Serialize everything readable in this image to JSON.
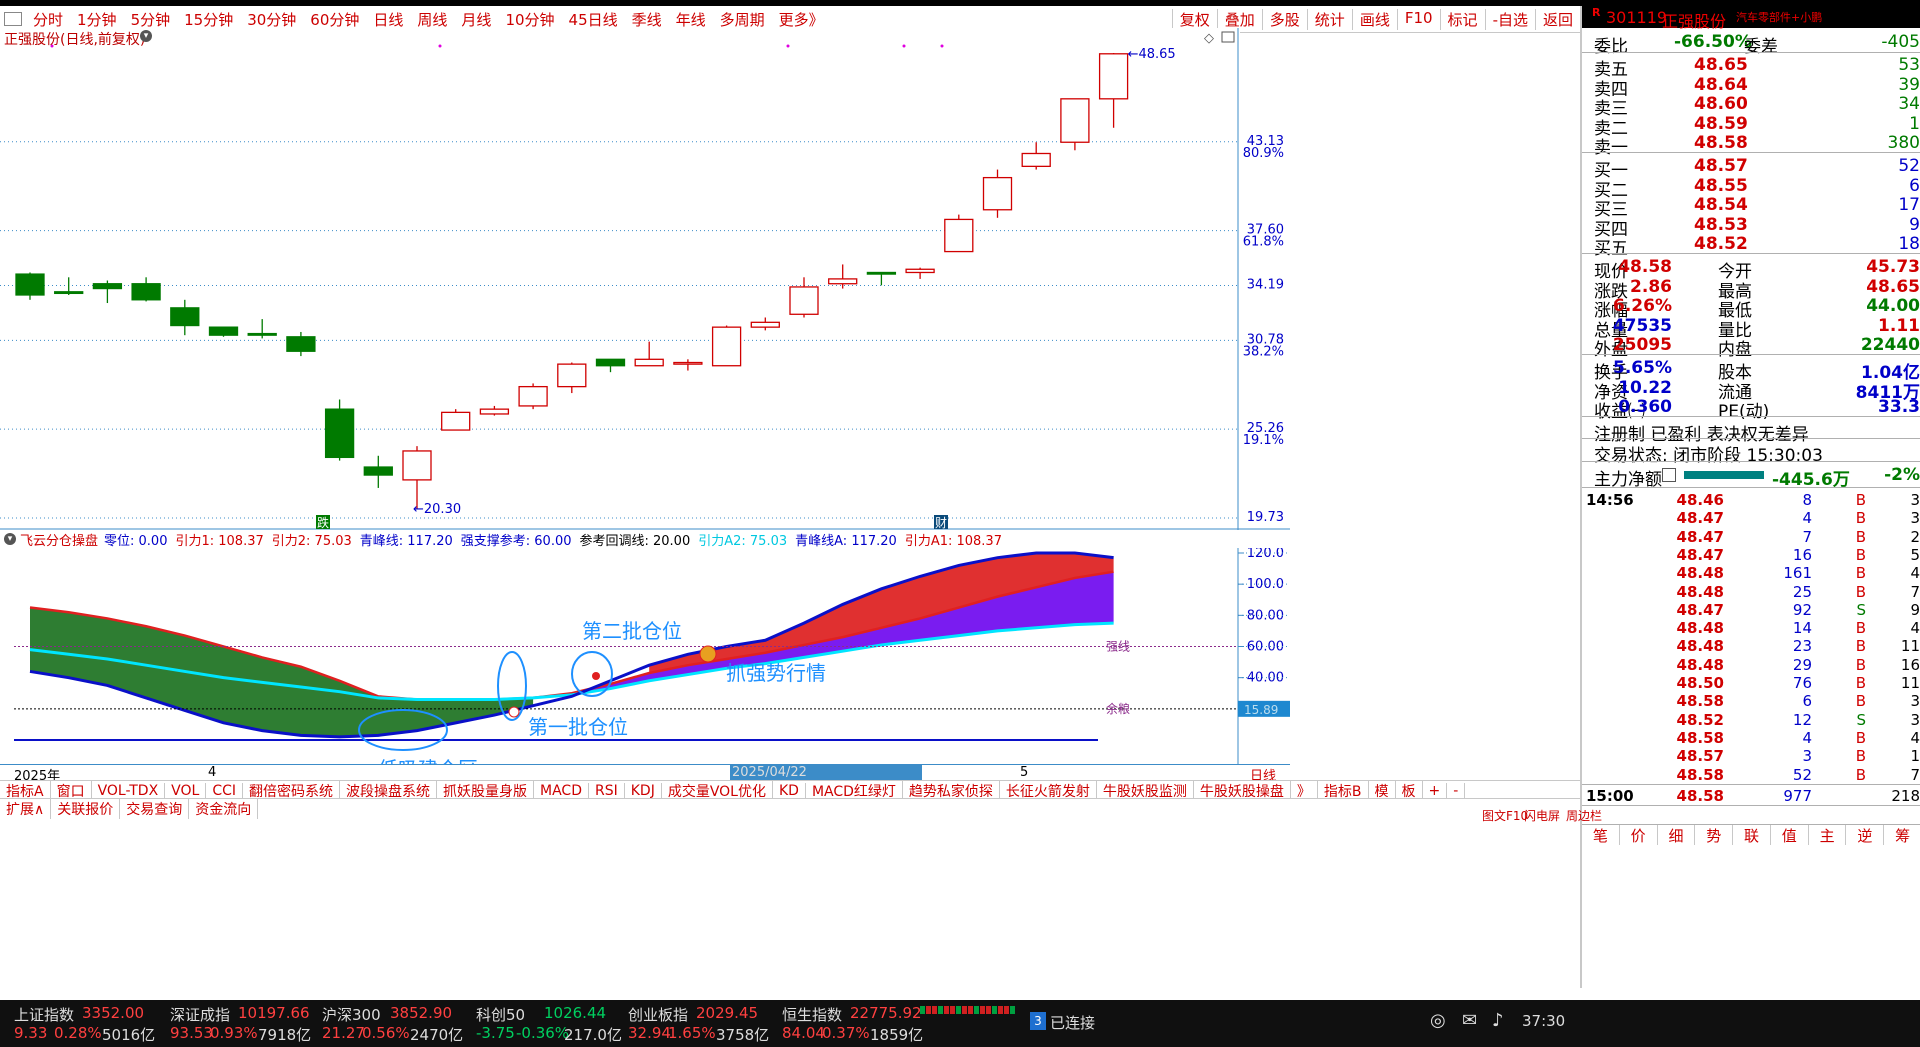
{
  "period_tabs": [
    "分时",
    "1分钟",
    "5分钟",
    "15分钟",
    "30分钟",
    "60分钟",
    "日线",
    "周线",
    "月线",
    "10分钟",
    "45日线",
    "季线",
    "年线",
    "多周期",
    "更多》"
  ],
  "tools": [
    "复权",
    "叠加",
    "多股",
    "统计",
    "画线",
    "F10",
    "标记",
    "-自选",
    "返回"
  ],
  "chart_title": "正强股份(日线,前复权)",
  "main_chart": {
    "price_levels": [
      {
        "price": "43.13",
        "pct": "80.9%"
      },
      {
        "price": "37.60",
        "pct": "61.8%"
      },
      {
        "price": "34.19",
        "pct": ""
      },
      {
        "price": "30.78",
        "pct": "38.2%"
      },
      {
        "price": "25.26",
        "pct": "19.1%"
      },
      {
        "price": "19.73",
        "pct": ""
      }
    ],
    "high_label": "48.65",
    "low_label": "20.30",
    "marker_left": "跌",
    "marker_right": "财",
    "candles": [
      {
        "o": 34.9,
        "c": 33.6,
        "h": 35.0,
        "l": 33.3
      },
      {
        "o": 33.8,
        "c": 33.7,
        "h": 34.7,
        "l": 33.6
      },
      {
        "o": 34.3,
        "c": 34.0,
        "h": 34.5,
        "l": 33.1
      },
      {
        "o": 34.3,
        "c": 33.3,
        "h": 34.7,
        "l": 33.2
      },
      {
        "o": 32.8,
        "c": 31.7,
        "h": 33.3,
        "l": 31.1
      },
      {
        "o": 31.6,
        "c": 31.1,
        "h": 31.6,
        "l": 31.0
      },
      {
        "o": 31.2,
        "c": 31.1,
        "h": 32.1,
        "l": 30.9
      },
      {
        "o": 31.0,
        "c": 30.1,
        "h": 31.3,
        "l": 29.8
      },
      {
        "o": 26.5,
        "c": 23.5,
        "h": 27.1,
        "l": 23.3
      },
      {
        "o": 22.9,
        "c": 22.4,
        "h": 23.6,
        "l": 21.6
      },
      {
        "o": 22.1,
        "c": 23.9,
        "h": 24.2,
        "l": 20.3
      },
      {
        "o": 25.2,
        "c": 26.3,
        "h": 26.5,
        "l": 25.2
      },
      {
        "o": 26.2,
        "c": 26.5,
        "h": 26.7,
        "l": 26.1
      },
      {
        "o": 26.7,
        "c": 27.9,
        "h": 28.1,
        "l": 26.5
      },
      {
        "o": 27.9,
        "c": 29.3,
        "h": 29.4,
        "l": 27.5
      },
      {
        "o": 29.6,
        "c": 29.2,
        "h": 29.6,
        "l": 28.8
      },
      {
        "o": 29.2,
        "c": 29.6,
        "h": 30.7,
        "l": 29.2
      },
      {
        "o": 29.3,
        "c": 29.4,
        "h": 29.6,
        "l": 28.9
      },
      {
        "o": 29.2,
        "c": 31.6,
        "h": 31.7,
        "l": 29.2
      },
      {
        "o": 31.6,
        "c": 31.9,
        "h": 32.2,
        "l": 31.4
      },
      {
        "o": 32.4,
        "c": 34.1,
        "h": 34.7,
        "l": 32.2
      },
      {
        "o": 34.3,
        "c": 34.6,
        "h": 35.5,
        "l": 34.0
      },
      {
        "o": 35.0,
        "c": 34.9,
        "h": 35.0,
        "l": 34.2
      },
      {
        "o": 35.0,
        "c": 35.2,
        "h": 35.3,
        "l": 34.6
      },
      {
        "o": 36.3,
        "c": 38.3,
        "h": 38.6,
        "l": 36.3
      },
      {
        "o": 38.9,
        "c": 40.9,
        "h": 41.4,
        "l": 38.4
      },
      {
        "o": 41.6,
        "c": 42.4,
        "h": 43.1,
        "l": 41.4
      },
      {
        "o": 43.1,
        "c": 45.8,
        "h": 45.8,
        "l": 42.6
      },
      {
        "o": 45.8,
        "c": 48.6,
        "h": 48.65,
        "l": 44.0
      }
    ]
  },
  "indicator": {
    "name": "飞云分仓操盘",
    "params": [
      {
        "text": "零位: 0.00",
        "color": "#0000c8"
      },
      {
        "text": "引力1: 108.37",
        "color": "#d00000"
      },
      {
        "text": "引力2: 75.03",
        "color": "#d00000"
      },
      {
        "text": "青峰线: 117.20",
        "color": "#0000c8"
      },
      {
        "text": "强支撑参考: 60.00",
        "color": "#0000c8"
      },
      {
        "text": "参考回调线: 20.00",
        "color": "#000"
      },
      {
        "text": "引力A2: 75.03",
        "color": "#00c8e0"
      },
      {
        "text": "青峰线A: 117.20",
        "color": "#0000c8"
      },
      {
        "text": "引力A1: 108.37",
        "color": "#d00000"
      }
    ],
    "axis": [
      "120.0",
      "100.0",
      "80.00",
      "60.00",
      "40.00"
    ],
    "strong_label": "强线",
    "support_label": "余粮",
    "value_badge": "15.89",
    "annotations": {
      "a1": "低吸建仓区",
      "a2": "第一批仓位",
      "a3": "第二批仓位",
      "a4": "抓强势行情"
    }
  },
  "date_axis": {
    "left": "2025年",
    "m1": "4",
    "m2": "5",
    "highlight": "2025/04/22",
    "period": "日线"
  },
  "indicator_tabs_row1": [
    "指标A",
    "窗口",
    "VOL-TDX",
    "VOL",
    "CCI",
    "翻倍密码系统",
    "波段操盘系统",
    "抓妖股量身版",
    "MACD",
    "RSI",
    "KDJ",
    "成交量VOL优化",
    "KD",
    "MACD红绿灯",
    "趋势私家侦探",
    "长征火箭发射",
    "牛股妖股监测",
    "牛股妖股操盘",
    "》",
    "指标B",
    "模",
    "板",
    "+",
    "-"
  ],
  "indicator_tabs_row2": [
    "扩展∧",
    "关联报价",
    "交易查询",
    "资金流向"
  ],
  "sidebar": {
    "code": "301119",
    "name": "正强股份",
    "sector": "汽车零部件+小鹏",
    "webi": {
      "label": "委比",
      "pct": "-66.50%",
      "label2": "委差",
      "val": "-405"
    },
    "sells": [
      {
        "label": "卖五",
        "price": "48.65",
        "vol": "53"
      },
      {
        "label": "卖四",
        "price": "48.64",
        "vol": "39"
      },
      {
        "label": "卖三",
        "price": "48.60",
        "vol": "34"
      },
      {
        "label": "卖二",
        "price": "48.59",
        "vol": "1"
      },
      {
        "label": "卖一",
        "price": "48.58",
        "vol": "380"
      }
    ],
    "buys": [
      {
        "label": "买一",
        "price": "48.57",
        "vol": "52"
      },
      {
        "label": "买二",
        "price": "48.55",
        "vol": "6"
      },
      {
        "label": "买三",
        "price": "48.54",
        "vol": "17"
      },
      {
        "label": "买四",
        "price": "48.53",
        "vol": "9"
      },
      {
        "label": "买五",
        "price": "48.52",
        "vol": "18"
      }
    ],
    "stats": [
      {
        "l1": "现价",
        "v1": "48.58",
        "l2": "今开",
        "v2": "45.73",
        "c1": "red",
        "c2": "red"
      },
      {
        "l1": "涨跌",
        "v1": "2.86",
        "l2": "最高",
        "v2": "48.65",
        "c1": "red",
        "c2": "red"
      },
      {
        "l1": "涨幅",
        "v1": "6.26%",
        "l2": "最低",
        "v2": "44.00",
        "c1": "red",
        "c2": "green"
      },
      {
        "l1": "总量",
        "v1": "47535",
        "l2": "量比",
        "v2": "1.11",
        "c1": "blue",
        "c2": "red"
      },
      {
        "l1": "外盘",
        "v1": "25095",
        "l2": "内盘",
        "v2": "22440",
        "c1": "red",
        "c2": "green"
      }
    ],
    "stats2": [
      {
        "l1": "换手",
        "v1": "5.65%",
        "l2": "股本",
        "v2": "1.04亿"
      },
      {
        "l1": "净资",
        "v1": "10.22",
        "l2": "流通",
        "v2": "8411万"
      },
      {
        "l1": "收益㈠",
        "v1": "0.360",
        "l2": "PE(动)",
        "v2": "33.3"
      }
    ],
    "reg": "注册制 已盈利 表决权无差异",
    "trade_state": "交易状态: 闭市阶段 15:30:03",
    "main_flow": {
      "label": "主力净额",
      "val": "-445.6万",
      "pct": "-2%"
    },
    "ticks_first_time": "14:56",
    "ticks": [
      {
        "p": "48.46",
        "v": "8",
        "bs": "B",
        "n": "3"
      },
      {
        "p": "48.47",
        "v": "4",
        "bs": "B",
        "n": "3"
      },
      {
        "p": "48.47",
        "v": "7",
        "bs": "B",
        "n": "2"
      },
      {
        "p": "48.47",
        "v": "16",
        "bs": "B",
        "n": "5"
      },
      {
        "p": "48.48",
        "v": "161",
        "bs": "B",
        "n": "4"
      },
      {
        "p": "48.48",
        "v": "25",
        "bs": "B",
        "n": "7"
      },
      {
        "p": "48.47",
        "v": "92",
        "bs": "S",
        "n": "9"
      },
      {
        "p": "48.48",
        "v": "14",
        "bs": "B",
        "n": "4"
      },
      {
        "p": "48.48",
        "v": "23",
        "bs": "B",
        "n": "11"
      },
      {
        "p": "48.48",
        "v": "29",
        "bs": "B",
        "n": "16"
      },
      {
        "p": "48.50",
        "v": "76",
        "bs": "B",
        "n": "11"
      },
      {
        "p": "48.58",
        "v": "6",
        "bs": "B",
        "n": "3"
      },
      {
        "p": "48.52",
        "v": "12",
        "bs": "S",
        "n": "3"
      },
      {
        "p": "48.58",
        "v": "4",
        "bs": "B",
        "n": "4"
      },
      {
        "p": "48.57",
        "v": "3",
        "bs": "B",
        "n": "1"
      },
      {
        "p": "48.58",
        "v": "52",
        "bs": "B",
        "n": "7"
      }
    ],
    "last_tick": {
      "t": "15:00",
      "p": "48.58",
      "v": "977",
      "n": "218"
    },
    "bottom_tabs": [
      "笔",
      "价",
      "细",
      "势",
      "联",
      "值",
      "主",
      "逆",
      "筹"
    ],
    "f10_tabs": [
      "图文F10",
      "闪电屏",
      "周边栏"
    ]
  },
  "ticker": [
    {
      "name": "上证指数",
      "val": "3352.00",
      "chg": "9.33",
      "pct": "0.28%",
      "amt": "5016亿"
    },
    {
      "name": "深证成指",
      "val": "10197.66",
      "chg": "93.53",
      "pct": "0.93%",
      "amt": "7918亿"
    },
    {
      "name": "沪深300",
      "val": "3852.90",
      "chg": "21.27",
      "pct": "0.56%",
      "amt": "2470亿"
    },
    {
      "name": "科创50",
      "val": "1026.44",
      "chg": "-3.75",
      "pct": "-0.36%",
      "amt": "217.0亿"
    },
    {
      "name": "创业板指",
      "val": "2029.45",
      "chg": "32.94",
      "pct": "1.65%",
      "amt": "3758亿"
    },
    {
      "name": "恒生指数",
      "val": "22775.92",
      "chg": "84.04",
      "pct": "0.37%",
      "amt": "1859亿"
    }
  ],
  "connection": {
    "count": "3",
    "label": "已连接",
    "time": "37:30"
  },
  "colors": {
    "up": "#d00000",
    "down": "#007a00",
    "accent": "#0000c8",
    "gridline": "#3c8cc8"
  }
}
